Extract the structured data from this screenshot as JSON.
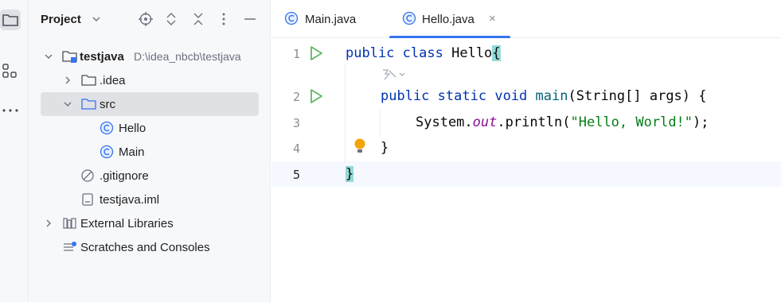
{
  "sidebar_strip": {
    "icons": [
      "folder-icon",
      "structure-icon",
      "more-icon"
    ]
  },
  "project_panel": {
    "title": "Project",
    "header_icons": [
      "target-icon",
      "expand-all-icon",
      "collapse-all-icon",
      "options-icon",
      "hide-icon"
    ],
    "tree": [
      {
        "label": "testjava",
        "path": "D:\\idea_nbcb\\testjava",
        "icon": "module-folder-icon",
        "expanded": true
      },
      {
        "label": ".idea",
        "icon": "folder-icon",
        "expanded": false
      },
      {
        "label": "src",
        "icon": "source-folder-icon",
        "expanded": true,
        "selected": true
      },
      {
        "label": "Hello",
        "icon": "java-class-icon"
      },
      {
        "label": "Main",
        "icon": "java-class-icon"
      },
      {
        "label": ".gitignore",
        "icon": "ignore-file-icon"
      },
      {
        "label": "testjava.iml",
        "icon": "iml-file-icon"
      },
      {
        "label": "External Libraries",
        "icon": "libraries-icon",
        "expanded": false
      },
      {
        "label": "Scratches and Consoles",
        "icon": "scratches-icon"
      }
    ]
  },
  "tabs": [
    {
      "label": "Main.java",
      "active": false
    },
    {
      "label": "Hello.java",
      "active": true,
      "close": "×"
    }
  ],
  "editor": {
    "line_numbers": [
      "1",
      "2",
      "3",
      "4",
      "5"
    ],
    "lines": {
      "l1": {
        "kw1": "public",
        "kw2": "class",
        "name": "Hello",
        "brace": "{"
      },
      "l2": {
        "kw1": "public",
        "kw2": "static",
        "kw3": "void",
        "fn": "main",
        "params": "(String[] args) {"
      },
      "l3": {
        "obj": "System.",
        "field": "out",
        "call": ".println(",
        "str": "\"Hello, World!\"",
        "end": ");"
      },
      "l4": {
        "brace": "}"
      },
      "l5": {
        "brace": "}"
      }
    }
  },
  "colors": {
    "accent": "#3574f0",
    "run_green": "#5fb865",
    "keyword": "#0033b3",
    "string": "#067d17",
    "field": "#871094",
    "brace_match": "#93d9d9",
    "bulb": "#f2a603"
  }
}
